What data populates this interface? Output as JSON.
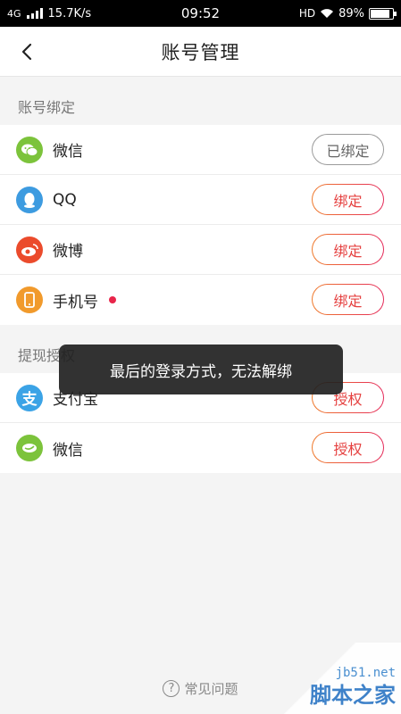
{
  "status_bar": {
    "network": "4G",
    "speed": "15.7K/s",
    "time": "09:52",
    "hd": "HD",
    "battery": "89%",
    "battery_level": 0.89
  },
  "header": {
    "title": "账号管理"
  },
  "binding_section": {
    "label": "账号绑定",
    "items": [
      {
        "label": "微信",
        "button": "已绑定",
        "icon": "wechat-icon",
        "color": "#7cc33b"
      },
      {
        "label": "QQ",
        "button": "绑定",
        "icon": "qq-icon",
        "color": "#3d9be0"
      },
      {
        "label": "微博",
        "button": "绑定",
        "icon": "weibo-icon",
        "color": "#eb4b2c"
      },
      {
        "label": "手机号",
        "button": "绑定",
        "icon": "phone-icon",
        "color": "#f19a2c"
      }
    ]
  },
  "withdraw_section": {
    "label": "提现授权",
    "items": [
      {
        "label": "支付宝",
        "button": "授权",
        "icon": "alipay-icon",
        "color": "#3ba3e6"
      },
      {
        "label": "微信",
        "button": "授权",
        "icon": "wechat-pay-icon",
        "color": "#7cc33b"
      }
    ]
  },
  "toast": {
    "message": "最后的登录方式，无法解绑"
  },
  "footer": {
    "faq_label": "常见问题"
  },
  "watermark": {
    "url": "jb51.net",
    "name": "脚本之家"
  }
}
